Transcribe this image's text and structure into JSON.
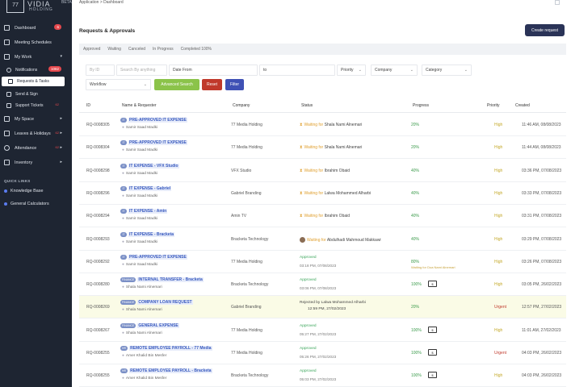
{
  "sidebar": {
    "logo": {
      "mark": "77",
      "name": "VIDIA",
      "sub": "HOLDING",
      "beta": "BETA"
    },
    "items": [
      {
        "label": "Dashboard",
        "badge": "6"
      },
      {
        "label": "Meeting Schedules"
      },
      {
        "label": "My Work",
        "arrow": "▾"
      },
      {
        "label": "Notifications",
        "badge": "1082"
      },
      {
        "label": "Requests & Tasks"
      },
      {
        "label": "Send & Sign"
      },
      {
        "label": "Support Tickets",
        "note": "62"
      },
      {
        "label": "My Space",
        "arrow": "▸"
      },
      {
        "label": "Leaves & Holidays",
        "arrow": "▸",
        "note": "62"
      },
      {
        "label": "Attendance",
        "arrow": "▸",
        "note": "62"
      },
      {
        "label": "Inventory",
        "arrow": "▸"
      }
    ],
    "quick_links_title": "QUICK LINKS",
    "quick_links": [
      "Knowledge Base",
      "General Calculators"
    ]
  },
  "breadcrumb": "Application  >  Dashboard",
  "page_title": "Requests & Approvals",
  "create_button": "Create request",
  "tabs": [
    "Approved",
    "Waiting",
    "Canceled",
    "In Progress",
    "Completed 100%"
  ],
  "filters": {
    "id_placeholder": "By ID",
    "search_placeholder": "Search By anything",
    "date_from": "Date From",
    "date_to": "to",
    "priority": "Priority",
    "company": "Company",
    "category": "Category",
    "workflow": "Workflow",
    "advanced_search": "Advanced Search",
    "reset": "Reset",
    "filter": "Filter"
  },
  "colors": {
    "sidebar": "#1e2532",
    "primary": "#2a3357",
    "advanced": "#8bc34a",
    "reset": "#c0392b",
    "filter": "#3f51b5"
  },
  "table": {
    "headers": [
      "ID",
      "Name & Requester",
      "Company",
      "Status",
      "Progress",
      "Priority",
      "Created"
    ],
    "rows": [
      {
        "id": "RQ-0008305",
        "tag": "IT",
        "title": "PRE-APPROVED IT EXPENSE",
        "requester": "Samir Saad Madki",
        "company": "77 Media Holding",
        "status_prefix": "Waiting for",
        "status_who": "Shala Nami Alnemari",
        "progress": "20%",
        "priority": "High",
        "priority_class": "high",
        "created": "11:46 AM, 08/08/2023"
      },
      {
        "id": "RQ-0008304",
        "tag": "IT",
        "title": "PRE-APPROVED IT EXPENSE",
        "requester": "Samir Saad Madki",
        "company": "77 Media Holding",
        "status_prefix": "Waiting for",
        "status_who": "Shala Nami Alnemari",
        "progress": "20%",
        "priority": "High",
        "priority_class": "high",
        "created": "11:44 AM, 08/08/2023"
      },
      {
        "id": "RQ-0008298",
        "tag": "IT",
        "title": "IT EXPENSE - VFX Studio",
        "requester": "Samir Saad Madki",
        "company": "VFX Studio",
        "status_prefix": "Waiting for",
        "status_who": "Ibrahim Obaid",
        "progress": "40%",
        "priority": "High",
        "priority_class": "high",
        "created": "03:36 PM, 07/08/2023"
      },
      {
        "id": "RQ-0008296",
        "tag": "IT",
        "title": "IT EXPENSE - Gabriel",
        "requester": "Samir Saad Madki",
        "company": "Gabriel Branding",
        "status_prefix": "Waiting for",
        "status_who": "Lalwa Mohammed Alharbi",
        "progress": "40%",
        "priority": "High",
        "priority_class": "high",
        "created": "03:33 PM, 07/08/2023"
      },
      {
        "id": "RQ-0008294",
        "tag": "IT",
        "title": "IT EXPENSE - Amin",
        "requester": "Samir Saad Madki",
        "company": "Amin TV",
        "status_prefix": "Waiting for",
        "status_who": "Ibrahim Obaid",
        "progress": "40%",
        "priority": "High",
        "priority_class": "high",
        "created": "03:31 PM, 07/08/2023"
      },
      {
        "id": "RQ-0008293",
        "tag": "IT",
        "title": "IT EXPENSE - Bracketa",
        "requester": "Samir Saad Madki",
        "company": "Bracketa Technology",
        "status_prefix": "Waiting for",
        "status_who": "Abdulhadi Mahmoud Makkawi",
        "progress": "40%",
        "priority": "High",
        "priority_class": "high",
        "created": "03:29 PM, 07/08/2023"
      },
      {
        "id": "RQ-0008292",
        "tag": "IT",
        "title": "PRE-APPROVED IT EXPENSE",
        "requester": "Samir Saad Madki",
        "company": "77 Media Holding",
        "approved_label": "Approved",
        "approved_time": "03:18 PM, 07/08/2023",
        "progress": "80%",
        "progress_note": "Waiting for Doa Nami Alnemari",
        "priority": "High",
        "priority_class": "high",
        "created": "03:26 PM, 07/08/2023"
      },
      {
        "id": "RQ-0008280",
        "tag": "FINANCE",
        "title": "INTERNAL TRANSFER - Bracketa",
        "requester": "Shala Nami Alnemari",
        "company": "Bracketa Technology",
        "approved_label": "Approved",
        "approved_time": "03:06 PM, 07/08/2023",
        "progress": "100%",
        "priority": "High",
        "priority_class": "high",
        "created": "03:05 PM, 26/02/2023"
      },
      {
        "id": "RQ-0008269",
        "tag": "FINANCE",
        "title": "COMPANY LOAN REQUEST",
        "requester": "Shala Nami Alnemari",
        "company": "Gabriel Branding",
        "rejected_label": "Rejected by Lalwa Mohammed Alharbi",
        "rejected_time": "12:59 PM, 27/02/2023",
        "progress": "20%",
        "priority": "Urgent",
        "priority_class": "urgent",
        "created": "12:57 PM, 27/02/2023",
        "highlight": true
      },
      {
        "id": "RQ-0008267",
        "tag": "FINANCE",
        "title": "GENERAL EXPENSE",
        "requester": "Shala Nami Alnemari",
        "company": "77 Media Holding",
        "approved_label": "Approved",
        "approved_time": "05:27 PM, 27/02/2023",
        "progress": "100%",
        "priority": "High",
        "priority_class": "high",
        "created": "11:01 AM, 27/02/2023"
      },
      {
        "id": "RQ-0008255",
        "tag": "HR",
        "title": "REMOTE EMPLOYEE PAYROLL - 77 Media",
        "requester": "Amer Khalid Bin Mesfer",
        "company": "77 Media Holding",
        "approved_label": "Approved",
        "approved_time": "05:26 PM, 27/02/2023",
        "progress": "100%",
        "priority": "Urgent",
        "priority_class": "urgent",
        "created": "04:03 PM, 26/02/2023"
      },
      {
        "id": "RQ-0008255",
        "tag": "HR",
        "title": "REMOTE EMPLOYEE PAYROLL - Bracketa",
        "requester": "Amer Khalid Bin Mesfer",
        "company": "Bracketa Technology",
        "approved_label": "Approved",
        "approved_time": "05:03 PM, 27/02/2023",
        "progress": "100%",
        "priority": "High",
        "priority_class": "high",
        "created": "04:03 PM, 26/02/2023"
      }
    ]
  }
}
